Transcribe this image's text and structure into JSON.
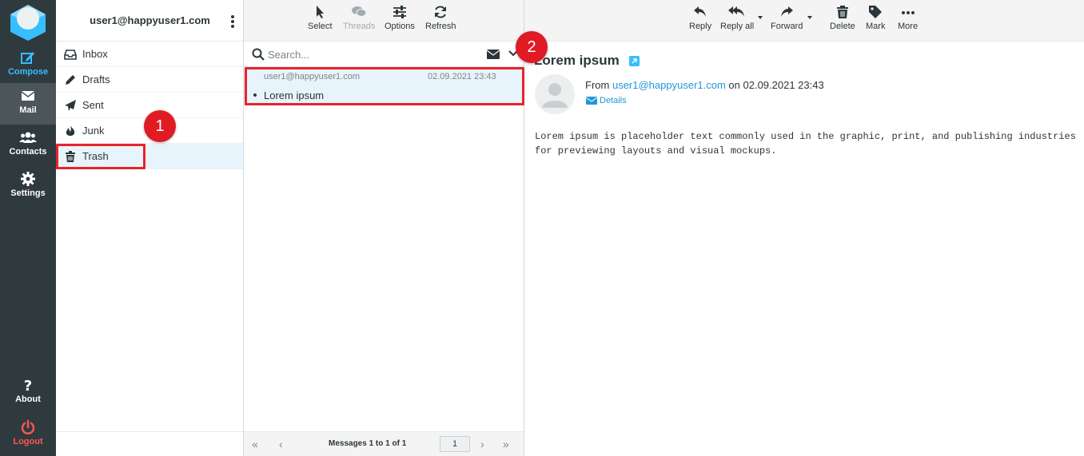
{
  "nav": {
    "compose": "Compose",
    "mail": "Mail",
    "contacts": "Contacts",
    "settings": "Settings",
    "about": "About",
    "logout": "Logout"
  },
  "account": "user1@happyuser1.com",
  "folders": [
    {
      "label": "Inbox",
      "icon": "inbox-icon"
    },
    {
      "label": "Drafts",
      "icon": "pencil-icon"
    },
    {
      "label": "Sent",
      "icon": "paper-plane-icon"
    },
    {
      "label": "Junk",
      "icon": "fire-icon"
    },
    {
      "label": "Trash",
      "icon": "trash-icon",
      "selected": true
    }
  ],
  "list_toolbar": {
    "select": "Select",
    "threads": "Threads",
    "options": "Options",
    "refresh": "Refresh"
  },
  "search": {
    "placeholder": "Search..."
  },
  "messages": [
    {
      "from": "user1@happyuser1.com",
      "date": "02.09.2021 23:43",
      "subject": "Lorem ipsum"
    }
  ],
  "pager": {
    "count": "Messages 1 to 1 of 1",
    "page": "1"
  },
  "reader_toolbar": {
    "reply": "Reply",
    "reply_all": "Reply all",
    "forward": "Forward",
    "delete": "Delete",
    "mark": "Mark",
    "more": "More"
  },
  "mail": {
    "subject": "Lorem ipsum",
    "from_prefix": "From",
    "from_address": "user1@happyuser1.com",
    "date_text": "on 02.09.2021 23:43",
    "details": "Details",
    "body": "Lorem ipsum is placeholder text commonly used in the graphic, print, and publishing industries for previewing layouts and visual mockups."
  },
  "annotations": {
    "marker1": "1",
    "marker2": "2"
  },
  "colors": {
    "accent": "#37beff",
    "nav_bg": "#2f3a3f",
    "highlight": "#e8232c",
    "logout": "#ff5552"
  }
}
